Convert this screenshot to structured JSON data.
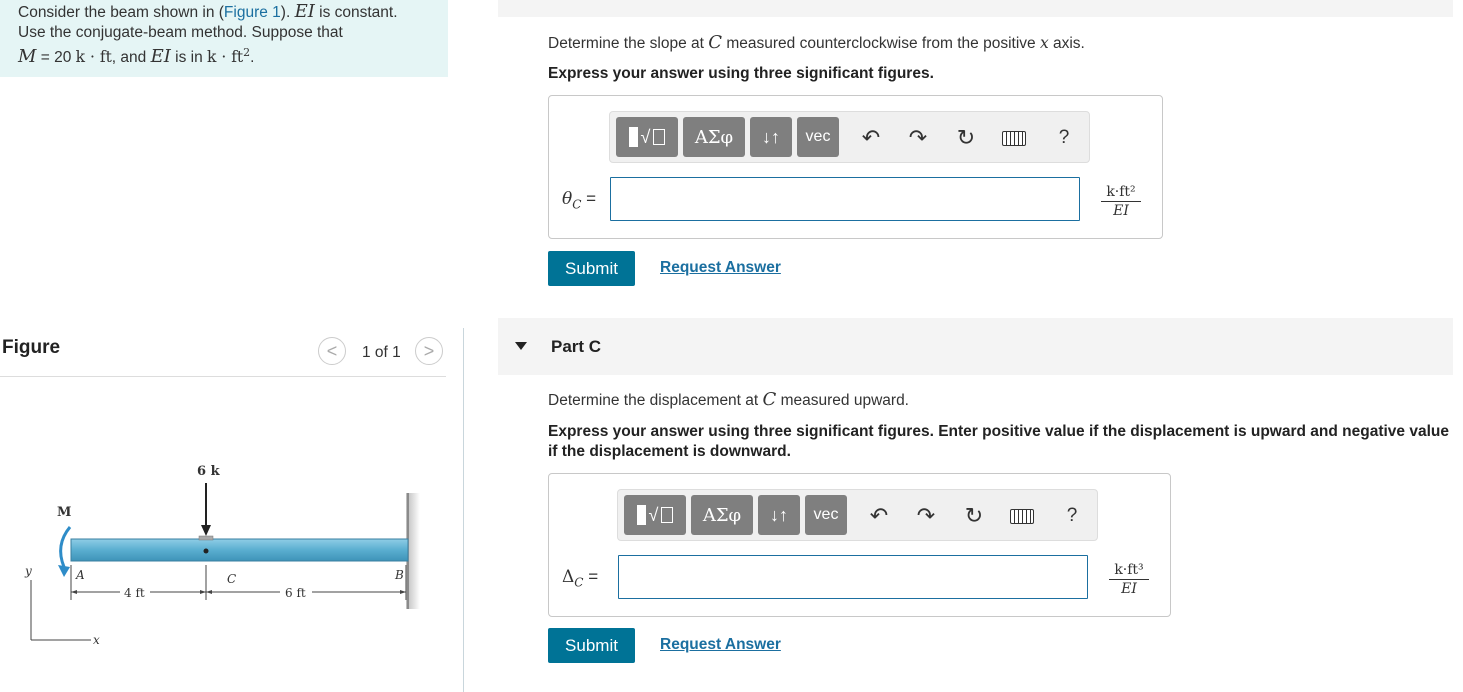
{
  "problem": {
    "line1_pre": "Consider the beam shown in (",
    "line1_link": "Figure 1",
    "line1_mid": "). ",
    "line1_ei": "EI",
    "line1_post": " is constant.",
    "line2": "Use the conjugate-beam method. Suppose that",
    "line3_M": "M",
    "line3_eq": " = 20 ",
    "line3_unit": "k · ft",
    "line3_and": ", and ",
    "line3_ei": "EI",
    "line3_isin": " is in ",
    "line3_unit2": "k · ft",
    "line3_sup": "2",
    "line3_end": "."
  },
  "figure": {
    "title": "Figure",
    "counter": "1 of 1",
    "prev_glyph": "<",
    "next_glyph": ">",
    "labels": {
      "load": "6 k",
      "moment": "M",
      "y_axis": "y",
      "x_axis": "x",
      "point_a": "A",
      "point_b": "B",
      "point_c": "C",
      "dim1": "4 ft",
      "dim2": "6 ft"
    }
  },
  "part_b": {
    "question_pre": "Determine the slope at ",
    "question_var": "C",
    "question_mid": " measured counterclockwise from the positive ",
    "question_var2": "x",
    "question_post": " axis.",
    "instruction": "Express your answer using three significant figures.",
    "answer_label": "θ",
    "answer_sub": "C",
    "answer_eq": " =",
    "answer_value": "",
    "units_num": "k·ft²",
    "units_den": "EI",
    "submit": "Submit",
    "request": "Request Answer"
  },
  "part_c": {
    "title": "Part C",
    "question_pre": "Determine the displacement at ",
    "question_var": "C",
    "question_post": " measured upward.",
    "instruction": "Express your answer using three significant figures. Enter positive value if the displacement is upward and negative value if the displacement is downward.",
    "answer_label": "Δ",
    "answer_sub": "C",
    "answer_eq": " =",
    "answer_value": "",
    "units_num": "k·ft³",
    "units_den": "EI",
    "submit": "Submit",
    "request": "Request Answer"
  },
  "toolbar": {
    "templates_icon": "templates-icon",
    "greek": "ΑΣφ",
    "arrows": "↓↑",
    "vec": "vec",
    "undo_icon": "undo-icon",
    "redo_icon": "redo-icon",
    "reset_icon": "reset-icon",
    "keyboard_icon": "keyboard-icon",
    "help": "?"
  },
  "colors": {
    "accent": "#007396",
    "link": "#1b6fa0",
    "problem_bg": "#e5f5f5",
    "beam": "#5aaed0"
  }
}
